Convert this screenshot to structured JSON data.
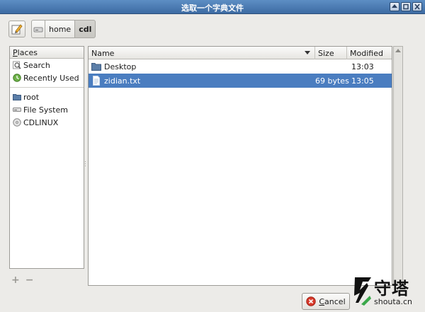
{
  "window": {
    "title": "选取一个字典文件"
  },
  "colors": {
    "titlebar": "#4a7bb5",
    "selection": "#4a7dc0",
    "folder": "#5b7ea8",
    "cancel_red": "#d93a2b"
  },
  "pathbar": {
    "segments": [
      "home",
      "cdl"
    ],
    "edit_icon": "edit-location-icon",
    "drive_icon": "drive-icon"
  },
  "places": {
    "header_first": "P",
    "header_rest": "laces",
    "items": [
      {
        "label": "Search",
        "icon": "search-icon"
      },
      {
        "label": "Recently Used",
        "icon": "recent-icon"
      }
    ],
    "devices": [
      {
        "label": "root",
        "icon": "folder-icon"
      },
      {
        "label": "File System",
        "icon": "drive-icon"
      },
      {
        "label": "CDLINUX",
        "icon": "disc-icon"
      }
    ],
    "add_label": "+",
    "remove_label": "−"
  },
  "files": {
    "columns": {
      "name": "Name",
      "size": "Size",
      "modified": "Modified"
    },
    "rows": [
      {
        "name": "Desktop",
        "size": "",
        "modified": "13:03",
        "icon": "folder-icon",
        "selected": false
      },
      {
        "name": "zidian.txt",
        "size": "69 bytes",
        "modified": "13:05",
        "icon": "text-file-icon",
        "selected": true
      }
    ]
  },
  "buttons": {
    "cancel_first": "C",
    "cancel_rest": "ancel"
  },
  "watermark": {
    "brand": "守塔",
    "url": "shouta.cn"
  }
}
